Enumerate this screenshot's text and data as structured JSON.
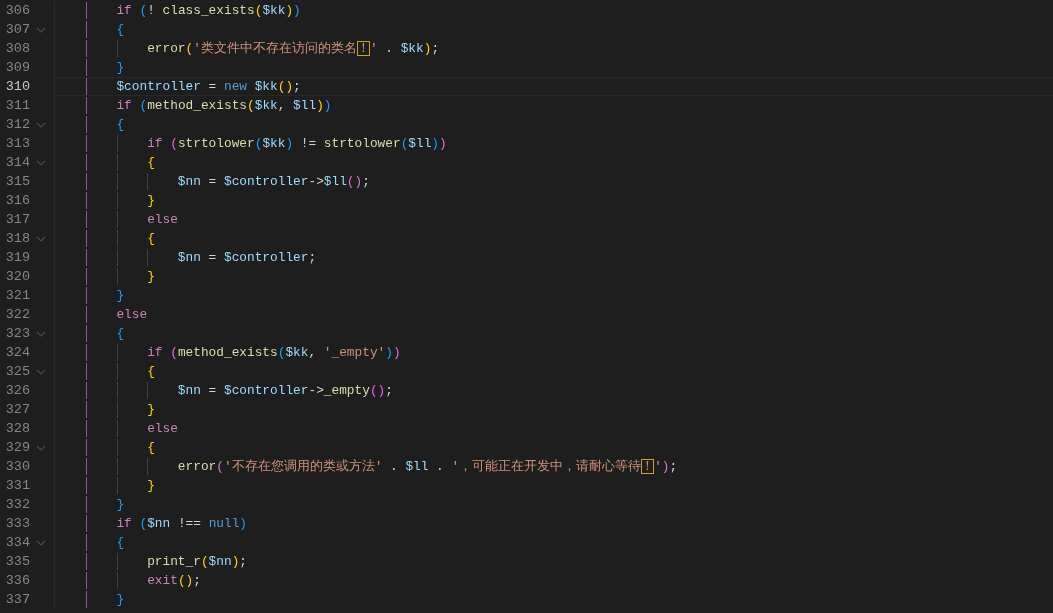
{
  "editor": {
    "lines": [
      {
        "number": "306",
        "fold": false,
        "current": false,
        "tokens": [
          {
            "kind": "kw",
            "text": "        if "
          },
          {
            "kind": "b3",
            "text": "("
          },
          {
            "kind": "plain",
            "text": "! "
          },
          {
            "kind": "fn",
            "text": "class_exists"
          },
          {
            "kind": "b1",
            "text": "("
          },
          {
            "kind": "var",
            "text": "$kk"
          },
          {
            "kind": "b1",
            "text": ")"
          },
          {
            "kind": "b3",
            "text": ")"
          }
        ]
      },
      {
        "number": "307",
        "fold": true,
        "current": false,
        "tokens": [
          {
            "kind": "b3",
            "text": "        {"
          }
        ]
      },
      {
        "number": "308",
        "fold": false,
        "current": false,
        "tokens": [
          {
            "kind": "fn",
            "text": "            error"
          },
          {
            "kind": "b1",
            "text": "("
          },
          {
            "kind": "str",
            "text": "'类文件中不存在访问的类名"
          },
          {
            "kind": "flag",
            "text": "！"
          },
          {
            "kind": "str",
            "text": "'"
          },
          {
            "kind": "plain",
            "text": " . "
          },
          {
            "kind": "var",
            "text": "$kk"
          },
          {
            "kind": "b1",
            "text": ")"
          },
          {
            "kind": "plain",
            "text": ";"
          }
        ]
      },
      {
        "number": "309",
        "fold": false,
        "current": false,
        "tokens": [
          {
            "kind": "b3",
            "text": "        }"
          }
        ]
      },
      {
        "number": "310",
        "fold": false,
        "current": true,
        "tokens": [
          {
            "kind": "var",
            "text": "        $controller"
          },
          {
            "kind": "plain",
            "text": " = "
          },
          {
            "kind": "storage",
            "text": "new "
          },
          {
            "kind": "var",
            "text": "$kk"
          },
          {
            "kind": "b1",
            "text": "()"
          },
          {
            "kind": "plain",
            "text": ";"
          }
        ]
      },
      {
        "number": "311",
        "fold": false,
        "current": false,
        "tokens": [
          {
            "kind": "kw",
            "text": "        if "
          },
          {
            "kind": "b3",
            "text": "("
          },
          {
            "kind": "fn",
            "text": "method_exists"
          },
          {
            "kind": "b1",
            "text": "("
          },
          {
            "kind": "var",
            "text": "$kk"
          },
          {
            "kind": "plain",
            "text": ", "
          },
          {
            "kind": "var",
            "text": "$ll"
          },
          {
            "kind": "b1",
            "text": ")"
          },
          {
            "kind": "b3",
            "text": ")"
          }
        ]
      },
      {
        "number": "312",
        "fold": true,
        "current": false,
        "tokens": [
          {
            "kind": "b3",
            "text": "        {"
          }
        ]
      },
      {
        "number": "313",
        "fold": false,
        "current": false,
        "tokens": [
          {
            "kind": "kw",
            "text": "            if "
          },
          {
            "kind": "b2",
            "text": "("
          },
          {
            "kind": "fn",
            "text": "strtolower"
          },
          {
            "kind": "b3",
            "text": "("
          },
          {
            "kind": "var",
            "text": "$kk"
          },
          {
            "kind": "b3",
            "text": ")"
          },
          {
            "kind": "plain",
            "text": " != "
          },
          {
            "kind": "fn",
            "text": "strtolower"
          },
          {
            "kind": "b3",
            "text": "("
          },
          {
            "kind": "var",
            "text": "$ll"
          },
          {
            "kind": "b3",
            "text": ")"
          },
          {
            "kind": "b2",
            "text": ")"
          }
        ]
      },
      {
        "number": "314",
        "fold": true,
        "current": false,
        "tokens": [
          {
            "kind": "b1",
            "text": "            {"
          }
        ]
      },
      {
        "number": "315",
        "fold": false,
        "current": false,
        "tokens": [
          {
            "kind": "var",
            "text": "                $nn"
          },
          {
            "kind": "plain",
            "text": " = "
          },
          {
            "kind": "var",
            "text": "$controller"
          },
          {
            "kind": "plain",
            "text": "->"
          },
          {
            "kind": "var",
            "text": "$ll"
          },
          {
            "kind": "b2",
            "text": "()"
          },
          {
            "kind": "plain",
            "text": ";"
          }
        ]
      },
      {
        "number": "316",
        "fold": false,
        "current": false,
        "tokens": [
          {
            "kind": "b1",
            "text": "            }"
          }
        ]
      },
      {
        "number": "317",
        "fold": false,
        "current": false,
        "tokens": [
          {
            "kind": "kw",
            "text": "            else"
          }
        ]
      },
      {
        "number": "318",
        "fold": true,
        "current": false,
        "tokens": [
          {
            "kind": "b1",
            "text": "            {"
          }
        ]
      },
      {
        "number": "319",
        "fold": false,
        "current": false,
        "tokens": [
          {
            "kind": "var",
            "text": "                $nn"
          },
          {
            "kind": "plain",
            "text": " = "
          },
          {
            "kind": "var",
            "text": "$controller"
          },
          {
            "kind": "plain",
            "text": ";"
          }
        ]
      },
      {
        "number": "320",
        "fold": false,
        "current": false,
        "tokens": [
          {
            "kind": "b1",
            "text": "            }"
          }
        ]
      },
      {
        "number": "321",
        "fold": false,
        "current": false,
        "tokens": [
          {
            "kind": "b3",
            "text": "        }"
          }
        ]
      },
      {
        "number": "322",
        "fold": false,
        "current": false,
        "tokens": [
          {
            "kind": "kw",
            "text": "        else"
          }
        ]
      },
      {
        "number": "323",
        "fold": true,
        "current": false,
        "tokens": [
          {
            "kind": "b3",
            "text": "        {"
          }
        ]
      },
      {
        "number": "324",
        "fold": false,
        "current": false,
        "tokens": [
          {
            "kind": "kw",
            "text": "            if "
          },
          {
            "kind": "b2",
            "text": "("
          },
          {
            "kind": "fn",
            "text": "method_exists"
          },
          {
            "kind": "b3",
            "text": "("
          },
          {
            "kind": "var",
            "text": "$kk"
          },
          {
            "kind": "plain",
            "text": ", "
          },
          {
            "kind": "str",
            "text": "'_empty'"
          },
          {
            "kind": "b3",
            "text": ")"
          },
          {
            "kind": "b2",
            "text": ")"
          }
        ]
      },
      {
        "number": "325",
        "fold": true,
        "current": false,
        "tokens": [
          {
            "kind": "b1",
            "text": "            {"
          }
        ]
      },
      {
        "number": "326",
        "fold": false,
        "current": false,
        "tokens": [
          {
            "kind": "var",
            "text": "                $nn"
          },
          {
            "kind": "plain",
            "text": " = "
          },
          {
            "kind": "var",
            "text": "$controller"
          },
          {
            "kind": "plain",
            "text": "->"
          },
          {
            "kind": "fn",
            "text": "_empty"
          },
          {
            "kind": "b2",
            "text": "()"
          },
          {
            "kind": "plain",
            "text": ";"
          }
        ]
      },
      {
        "number": "327",
        "fold": false,
        "current": false,
        "tokens": [
          {
            "kind": "b1",
            "text": "            }"
          }
        ]
      },
      {
        "number": "328",
        "fold": false,
        "current": false,
        "tokens": [
          {
            "kind": "kw",
            "text": "            else"
          }
        ]
      },
      {
        "number": "329",
        "fold": true,
        "current": false,
        "tokens": [
          {
            "kind": "b1",
            "text": "            {"
          }
        ]
      },
      {
        "number": "330",
        "fold": false,
        "current": false,
        "tokens": [
          {
            "kind": "fn",
            "text": "                error"
          },
          {
            "kind": "b2",
            "text": "("
          },
          {
            "kind": "str",
            "text": "'不存在您调用的类或方法'"
          },
          {
            "kind": "plain",
            "text": " . "
          },
          {
            "kind": "var",
            "text": "$ll"
          },
          {
            "kind": "plain",
            "text": " . "
          },
          {
            "kind": "str",
            "text": "'，可能正在开发中，请耐心等待"
          },
          {
            "kind": "flag",
            "text": "！"
          },
          {
            "kind": "str",
            "text": "'"
          },
          {
            "kind": "b2",
            "text": ")"
          },
          {
            "kind": "plain",
            "text": ";"
          }
        ]
      },
      {
        "number": "331",
        "fold": false,
        "current": false,
        "tokens": [
          {
            "kind": "b1",
            "text": "            }"
          }
        ]
      },
      {
        "number": "332",
        "fold": false,
        "current": false,
        "tokens": [
          {
            "kind": "b3",
            "text": "        }"
          }
        ]
      },
      {
        "number": "333",
        "fold": false,
        "current": false,
        "tokens": [
          {
            "kind": "kw",
            "text": "        if "
          },
          {
            "kind": "b3",
            "text": "("
          },
          {
            "kind": "var",
            "text": "$nn"
          },
          {
            "kind": "plain",
            "text": " !== "
          },
          {
            "kind": "storage",
            "text": "null"
          },
          {
            "kind": "b3",
            "text": ")"
          }
        ]
      },
      {
        "number": "334",
        "fold": true,
        "current": false,
        "tokens": [
          {
            "kind": "b3",
            "text": "        {"
          }
        ]
      },
      {
        "number": "335",
        "fold": false,
        "current": false,
        "tokens": [
          {
            "kind": "fn",
            "text": "            print_r"
          },
          {
            "kind": "b1",
            "text": "("
          },
          {
            "kind": "var",
            "text": "$nn"
          },
          {
            "kind": "b1",
            "text": ")"
          },
          {
            "kind": "plain",
            "text": ";"
          }
        ]
      },
      {
        "number": "336",
        "fold": false,
        "current": false,
        "tokens": [
          {
            "kind": "kw",
            "text": "            exit"
          },
          {
            "kind": "b1",
            "text": "()"
          },
          {
            "kind": "plain",
            "text": ";"
          }
        ]
      },
      {
        "number": "337",
        "fold": false,
        "current": false,
        "tokens": [
          {
            "kind": "b3",
            "text": "        }"
          }
        ]
      }
    ]
  }
}
